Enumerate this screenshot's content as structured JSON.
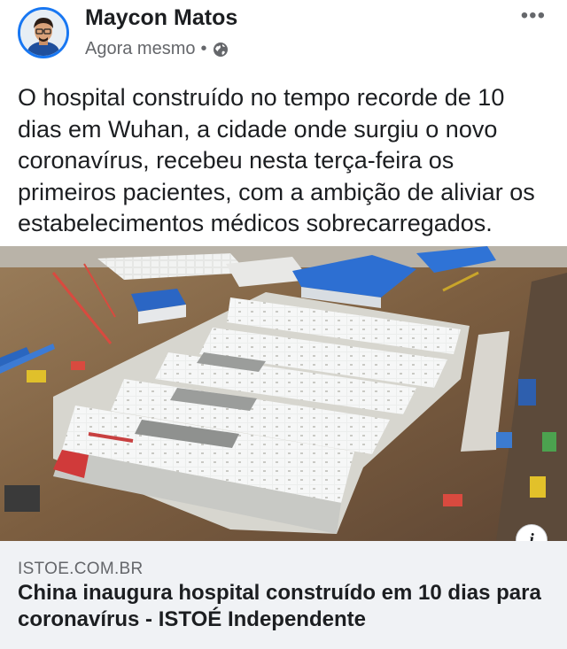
{
  "post": {
    "author": "Maycon Matos",
    "timestamp": "Agora mesmo",
    "separator": "•",
    "privacy_icon": "globe-icon",
    "more_label": "•••",
    "text": "O hospital construído no tempo recorde de 10 dias em Wuhan, a cidade onde surgiu o novo coronavírus, recebeu nesta terça-feira os primeiros pacientes, com a ambição de aliviar os estabelecimentos médicos sobrecarregados."
  },
  "link_preview": {
    "domain": "ISTOE.COM.BR",
    "title": "China inaugura hospital construído em 10 dias para coronavírus - ISTOÉ Independente",
    "info_label": "i"
  },
  "colors": {
    "accent": "#1877f2",
    "text": "#1c1e21",
    "secondary": "#65676b",
    "card_bg": "#f0f2f5"
  }
}
